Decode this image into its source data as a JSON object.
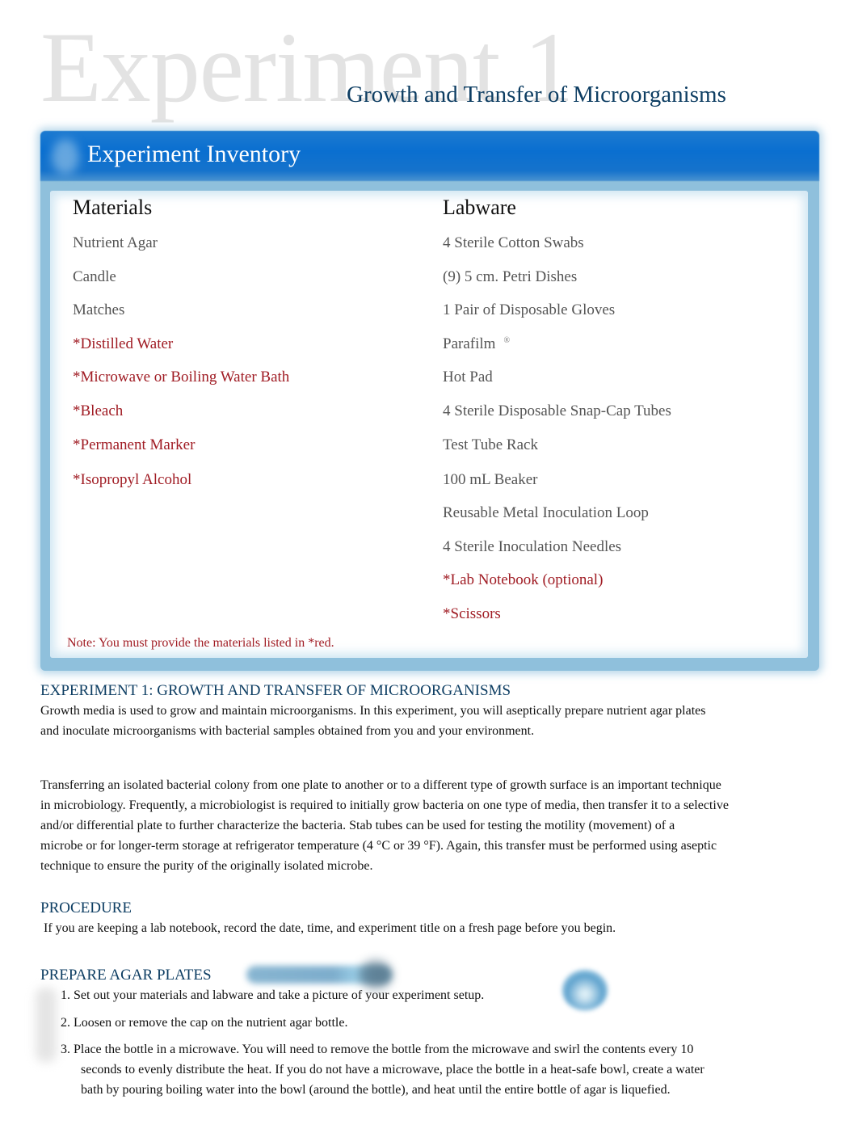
{
  "header": {
    "watermark": "Experiment 1",
    "subtitle": "Growth and Transfer of Microorganisms"
  },
  "inventory": {
    "title": "Experiment Inventory",
    "materials_heading": "Materials",
    "labware_heading": "Labware",
    "materials": [
      {
        "label": "Nutrient Agar",
        "user_provided": false
      },
      {
        "label": "Candle",
        "user_provided": false
      },
      {
        "label": "Matches",
        "user_provided": false
      },
      {
        "label": "*Distilled Water",
        "user_provided": true
      },
      {
        "label": "*Microwave or Boiling Water Bath",
        "user_provided": true
      },
      {
        "label": "*Bleach",
        "user_provided": true
      },
      {
        "label": "*Permanent Marker",
        "user_provided": true
      },
      {
        "label": "*Isopropyl Alcohol",
        "user_provided": true
      }
    ],
    "labware": [
      {
        "label": "4 Sterile Cotton Swabs",
        "user_provided": false
      },
      {
        "label": "(9) 5 cm. Petri Dishes",
        "user_provided": false
      },
      {
        "label": "1 Pair of Disposable Gloves",
        "user_provided": false
      },
      {
        "label": "Parafilm",
        "suffix": "®",
        "user_provided": false
      },
      {
        "label": "Hot Pad",
        "user_provided": false
      },
      {
        "label": "4 Sterile Disposable Snap-Cap Tubes",
        "user_provided": false
      },
      {
        "label": "Test Tube Rack",
        "user_provided": false
      },
      {
        "label": "100 mL Beaker",
        "user_provided": false
      },
      {
        "label": "Reusable Metal Inoculation Loop",
        "user_provided": false
      },
      {
        "label": "4 Sterile Inoculation Needles",
        "user_provided": false
      },
      {
        "label": "*Lab Notebook (optional)",
        "user_provided": true
      },
      {
        "label": "*Scissors",
        "user_provided": true
      }
    ],
    "note": "Note: You must provide the materials listed in *red."
  },
  "intro": {
    "heading": "EXPERIMENT 1: GROWTH AND TRANSFER OF MICROORGANISMS",
    "paragraph1": [
      "Growth media is used to grow and maintain microorganisms. In this experiment, you will aseptically prepare nutrient agar plates",
      "and inoculate microorganisms with bacterial samples obtained from you and your environment."
    ],
    "paragraph2": [
      "Transferring an isolated bacterial colony from one plate to another or to a different type of growth surface is an important technique",
      "in microbiology. Frequently, a microbiologist is required to initially grow bacteria on one type of media, then transfer it to a selective",
      "and/or differential plate to further characterize the bacteria. Stab tubes can be used for testing the motility (movement) of a",
      "microbe or for longer-term storage at refrigerator temperature (4 °C or 39 °F). Again, this transfer must be performed using aseptic",
      "technique to ensure the purity of the originally isolated microbe."
    ]
  },
  "procedure": {
    "heading": "PROCEDURE",
    "text": " If you are keeping a lab notebook, record the date, time, and experiment title on a fresh page before you begin."
  },
  "prepare_agar": {
    "heading": "PREPARE AGAR PLATES",
    "steps": [
      {
        "lines": [
          "1. Set out your materials and labware and take a picture of your experiment setup."
        ]
      },
      {
        "lines": [
          "2. Loosen or remove the cap on the nutrient agar bottle."
        ]
      },
      {
        "lines": [
          "3. Place the bottle in a microwave. You will need to remove the bottle from the microwave and swirl the contents every 10",
          "seconds to evenly distribute the heat. If you do not have a microwave, place the bottle in a heat-safe bowl, create a water",
          "bath by pouring boiling water into the bowl (around the bottle), and heat until the entire bottle of agar is liquefied."
        ]
      }
    ]
  },
  "colors": {
    "heading_blue": "#0e3e63",
    "banner_blue": "#0a6fd0",
    "user_provided_red": "#a01c24",
    "item_gray": "#555555"
  }
}
